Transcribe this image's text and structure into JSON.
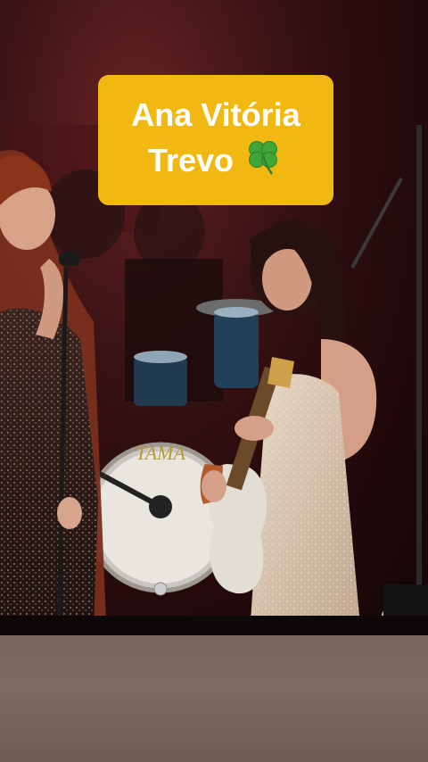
{
  "overlay": {
    "line1": "Ana Vitória",
    "line2": "Trevo",
    "emoji_icon": "four-leaf-clover-icon",
    "card_color": "#f2b812",
    "text_color": "#ffffff"
  },
  "scene": {
    "drum_logo": "TAMA"
  }
}
